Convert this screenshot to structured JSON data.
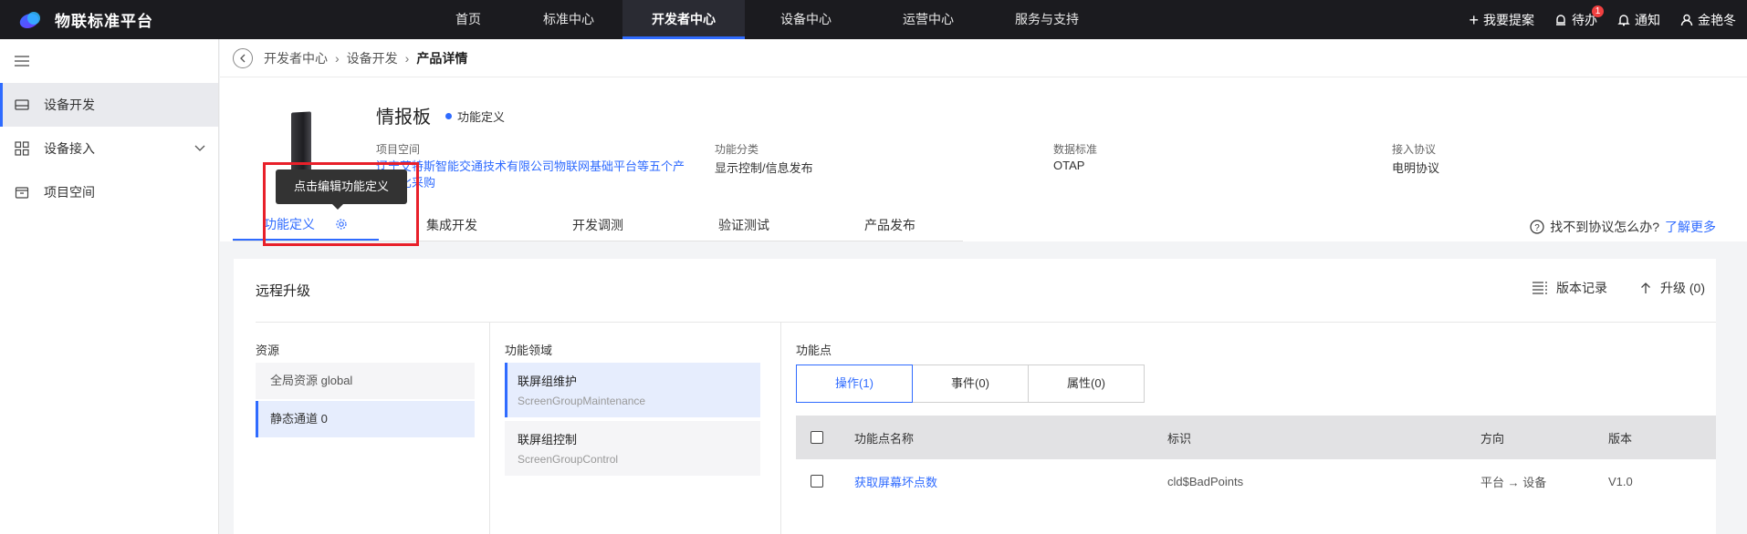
{
  "app": {
    "name": "物联标准平台"
  },
  "nav": {
    "items": [
      {
        "label": "首页"
      },
      {
        "label": "标准中心"
      },
      {
        "label": "开发者中心",
        "active": true
      },
      {
        "label": "设备中心"
      },
      {
        "label": "运营中心"
      },
      {
        "label": "服务与支持"
      }
    ]
  },
  "topright": {
    "suggest": "我要提案",
    "todo": "待办",
    "todo_count": "1",
    "notify": "通知",
    "user": "金艳冬"
  },
  "sidebar": {
    "items": [
      {
        "label": "设备开发",
        "icon": "device-icon",
        "active": true
      },
      {
        "label": "设备接入",
        "icon": "grid-icon"
      },
      {
        "label": "项目空间",
        "icon": "box-icon"
      }
    ]
  },
  "breadcrumb": {
    "items": [
      "开发者中心",
      "设备开发",
      "产品详情"
    ]
  },
  "product": {
    "name": "情报板",
    "status": "功能定义",
    "meta": [
      {
        "key": "项目空间",
        "value": "辽宁艾特斯智能交通技术有限公司物联网基础平台等五个产品询比采购"
      },
      {
        "key": "功能分类",
        "value": "显示控制/信息发布"
      },
      {
        "key": "数据标准",
        "value": "OTAP"
      },
      {
        "key": "接入协议",
        "value": "电明协议"
      }
    ],
    "tabs": [
      "功能定义",
      "集成开发",
      "开发调测",
      "验证测试",
      "产品发布"
    ],
    "help_text": "找不到协议怎么办?",
    "help_link": "了解更多",
    "tooltip": "点击编辑功能定义"
  },
  "content": {
    "title": "远程升级",
    "version_record": "版本记录",
    "upgrade": "升级 (0)",
    "resource_header": "资源",
    "resources": [
      "全局资源 global",
      "静态通道 0"
    ],
    "domain_header": "功能领域",
    "domains": [
      {
        "name": "联屏组维护",
        "en": "ScreenGroupMaintenance"
      },
      {
        "name": "联屏组控制",
        "en": "ScreenGroupControl"
      }
    ],
    "point_header": "功能点",
    "point_tabs": [
      "操作(1)",
      "事件(0)",
      "属性(0)"
    ],
    "table": {
      "columns": [
        "功能点名称",
        "标识",
        "方向",
        "版本"
      ],
      "rows": [
        {
          "name": "获取屏幕坏点数",
          "id": "cld$BadPoints",
          "direction": "平台 → 设备",
          "version": "V1.0"
        }
      ]
    }
  },
  "colors": {
    "accent": "#2f6bff",
    "topbar": "#1b1b1f",
    "highlight": "#e8202a"
  }
}
